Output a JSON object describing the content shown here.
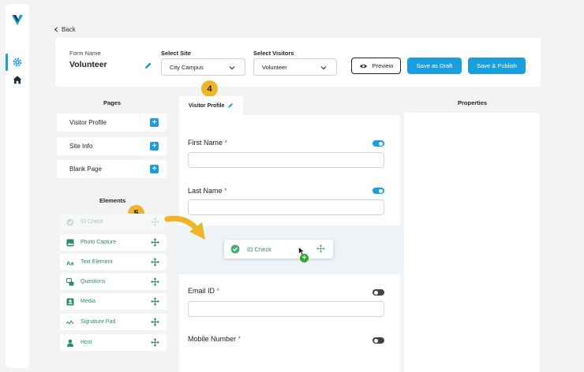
{
  "nav": {
    "back_label": "Back"
  },
  "form": {
    "name_label": "Form Name",
    "name_value": "Volunteer",
    "site_label": "Select Site",
    "site_value": "City Campus",
    "visitors_label": "Select Visitors",
    "visitors_value": "Volunteer"
  },
  "actions": {
    "preview": "Preview",
    "save_draft": "Save as Draft",
    "save_publish": "Save & Publish"
  },
  "pages": {
    "title": "Pages",
    "items": [
      "Visitor Profile",
      "Site Info",
      "Blank Page"
    ]
  },
  "elements": {
    "title": "Elements",
    "items": [
      {
        "label": "ID Check",
        "icon": "check-circle-icon"
      },
      {
        "label": "Photo Capture",
        "icon": "image-icon"
      },
      {
        "label": "Text Element",
        "icon": "text-icon"
      },
      {
        "label": "Questions",
        "icon": "questions-icon"
      },
      {
        "label": "Media",
        "icon": "media-icon"
      },
      {
        "label": "Signature Pad",
        "icon": "signature-icon"
      },
      {
        "label": "Host",
        "icon": "person-icon"
      }
    ]
  },
  "canvas": {
    "tab_label": "Visitor Profile",
    "fields": [
      {
        "label": "First Name",
        "required": "*",
        "enabled": true
      },
      {
        "label": "Last Name",
        "required": "*",
        "enabled": true
      },
      {
        "label": "Email ID",
        "required": "*",
        "enabled": false
      },
      {
        "label": "Mobile Number",
        "required": "*",
        "enabled": false
      }
    ],
    "dragging_label": "ID Check"
  },
  "properties": {
    "title": "Properties"
  },
  "steps": {
    "tab_step": "4",
    "elements_step": "5"
  },
  "colors": {
    "accent": "#1a9fdc",
    "element_green": "#2e8b6a",
    "badge": "#f0b429",
    "required": "#e04040"
  }
}
